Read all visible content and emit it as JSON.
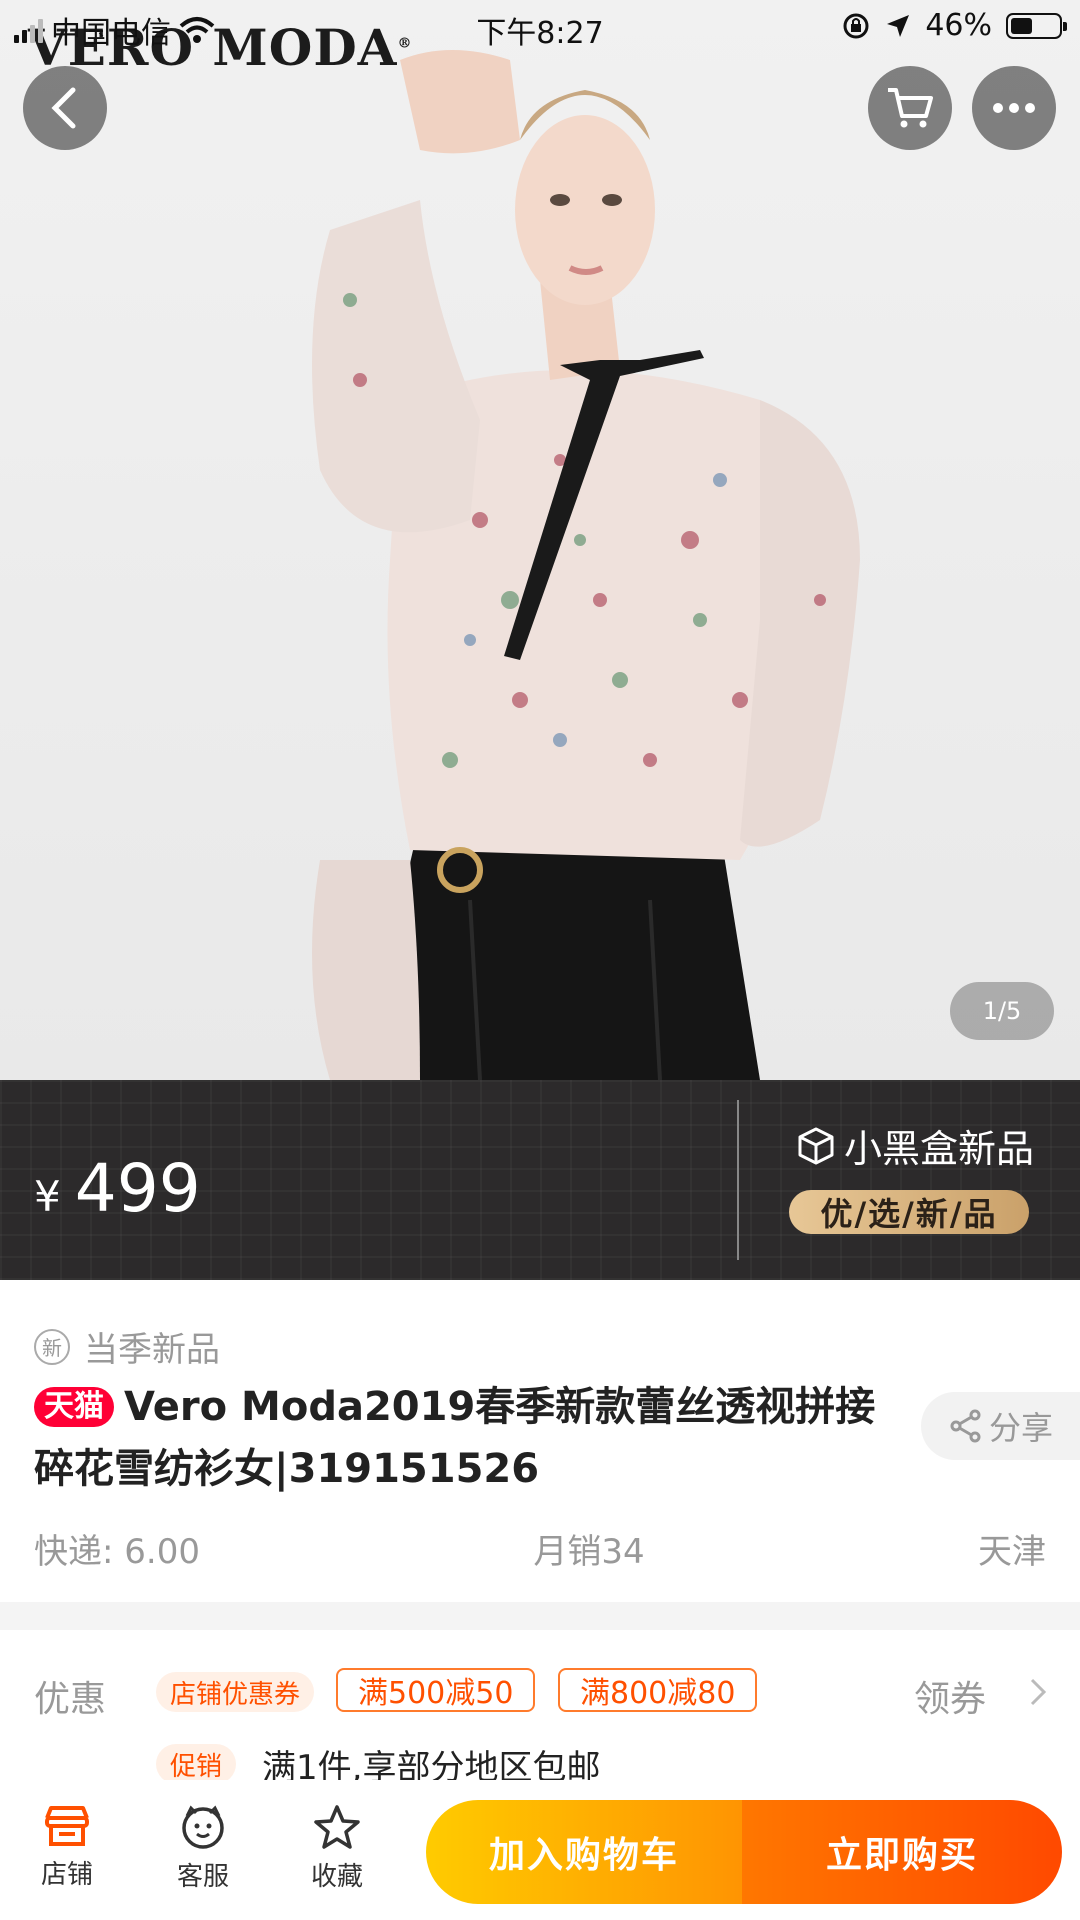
{
  "status_bar": {
    "carrier": "中国电信",
    "time": "下午8:27",
    "battery": "46%",
    "battery_level": 0.46
  },
  "hero": {
    "brand": "VERO MODA",
    "pager": "1/5"
  },
  "price_banner": {
    "currency": "¥",
    "price": "499",
    "box_title": "小黑盒新品",
    "box_tag": "优/选/新/品"
  },
  "info": {
    "new_badge": "新",
    "season_label": "当季新品",
    "tmall_badge": "天猫",
    "title": "Vero Moda2019春季新款蕾丝透视拼接碎花雪纺衫女|319151526",
    "share": "分享",
    "shipping": "快递: 6.00",
    "monthly_sales": "月销34",
    "location": "天津"
  },
  "promo": {
    "label": "优惠",
    "shop_coupon": "店铺优惠券",
    "coupons": [
      "满500减50",
      "满800减80"
    ],
    "get_coupon": "领券",
    "promo_tag": "促销",
    "promo_text": "满1件,享部分地区包邮"
  },
  "bottom_bar": {
    "shop": "店铺",
    "service": "客服",
    "favorite": "收藏",
    "add_to_cart": "加入购物车",
    "buy_now": "立即购买"
  },
  "colors": {
    "tmall_red": "#ff0036",
    "accent_orange": "#ff5000",
    "cart_yellow": "#ffcb00",
    "banner_dark": "#2c2a2b"
  }
}
